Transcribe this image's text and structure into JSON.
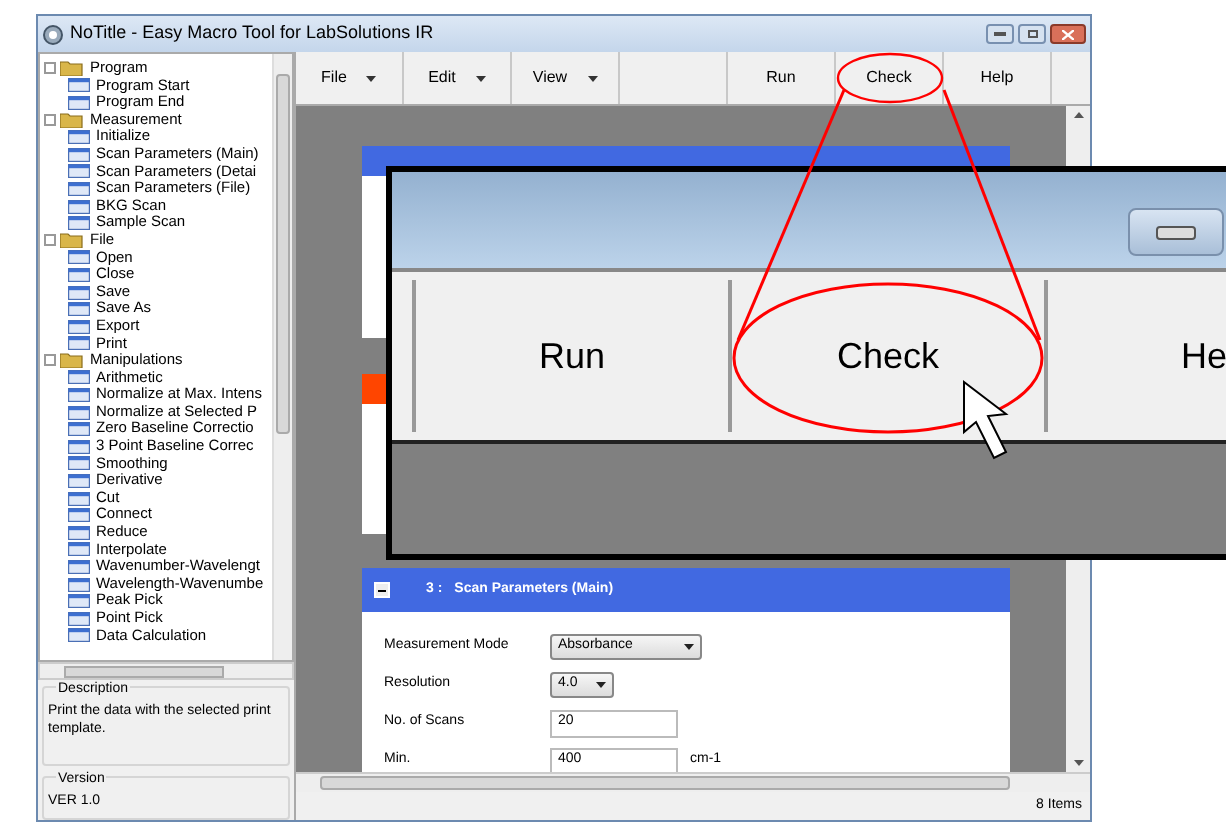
{
  "window": {
    "title": "NoTitle - Easy Macro Tool for LabSolutions IR"
  },
  "tree": [
    {
      "label": "Program",
      "children": [
        {
          "label": "Program Start"
        },
        {
          "label": "Program End"
        }
      ]
    },
    {
      "label": "Measurement",
      "children": [
        {
          "label": "Initialize"
        },
        {
          "label": "Scan Parameters (Main)"
        },
        {
          "label": "Scan Parameters (Detai"
        },
        {
          "label": "Scan Parameters (File)"
        },
        {
          "label": "BKG Scan"
        },
        {
          "label": "Sample Scan"
        }
      ]
    },
    {
      "label": "File",
      "children": [
        {
          "label": "Open"
        },
        {
          "label": "Close"
        },
        {
          "label": "Save"
        },
        {
          "label": "Save As"
        },
        {
          "label": "Export"
        },
        {
          "label": "Print"
        }
      ]
    },
    {
      "label": "Manipulations",
      "children": [
        {
          "label": "Arithmetic"
        },
        {
          "label": "Normalize at Max. Intens"
        },
        {
          "label": "Normalize at Selected P"
        },
        {
          "label": "Zero Baseline Correctio"
        },
        {
          "label": "3 Point Baseline Correc"
        },
        {
          "label": "Smoothing"
        },
        {
          "label": "Derivative"
        },
        {
          "label": "Cut"
        },
        {
          "label": "Connect"
        },
        {
          "label": "Reduce"
        },
        {
          "label": "Interpolate"
        },
        {
          "label": "Wavenumber-Wavelengt"
        },
        {
          "label": "Wavelength-Wavenumbe"
        },
        {
          "label": "Peak Pick"
        },
        {
          "label": "Point Pick"
        },
        {
          "label": "Data Calculation"
        }
      ]
    }
  ],
  "description": {
    "label": "Description",
    "text": "Print the data with the selected print template."
  },
  "version": {
    "label": "Version",
    "text": "VER 1.0"
  },
  "toolbar": [
    {
      "kind": "menu",
      "label": "File",
      "highlighted": false
    },
    {
      "kind": "menu",
      "label": "Edit",
      "highlighted": false
    },
    {
      "kind": "menu",
      "label": "View",
      "highlighted": false
    },
    {
      "kind": "spacer",
      "highlighted": false
    },
    {
      "kind": "button",
      "label": "Run",
      "highlighted": false
    },
    {
      "kind": "button",
      "label": "Check",
      "highlighted": true
    },
    {
      "kind": "button",
      "label": "Help",
      "highlighted": false
    }
  ],
  "cards": [
    {
      "color": "#4169e1"
    },
    {
      "color": "#ff4500"
    }
  ],
  "card": {
    "number": "3 :",
    "title": "Scan Parameters (Main)",
    "fields": [
      {
        "label": "Measurement Mode",
        "kind": "select",
        "value": "Absorbance"
      },
      {
        "label": "Resolution",
        "kind": "select",
        "value": "4.0"
      },
      {
        "label": "No. of Scans",
        "kind": "text",
        "value": "20"
      },
      {
        "label": "Min.",
        "kind": "text",
        "value": "400",
        "unit": "cm-1"
      }
    ]
  },
  "status_bar": "8 Items",
  "callout": {
    "buttons": [
      {
        "label": "Run",
        "highlighted": false
      },
      {
        "label": "Check",
        "highlighted": true
      },
      {
        "label": "He",
        "highlighted": false
      }
    ]
  }
}
